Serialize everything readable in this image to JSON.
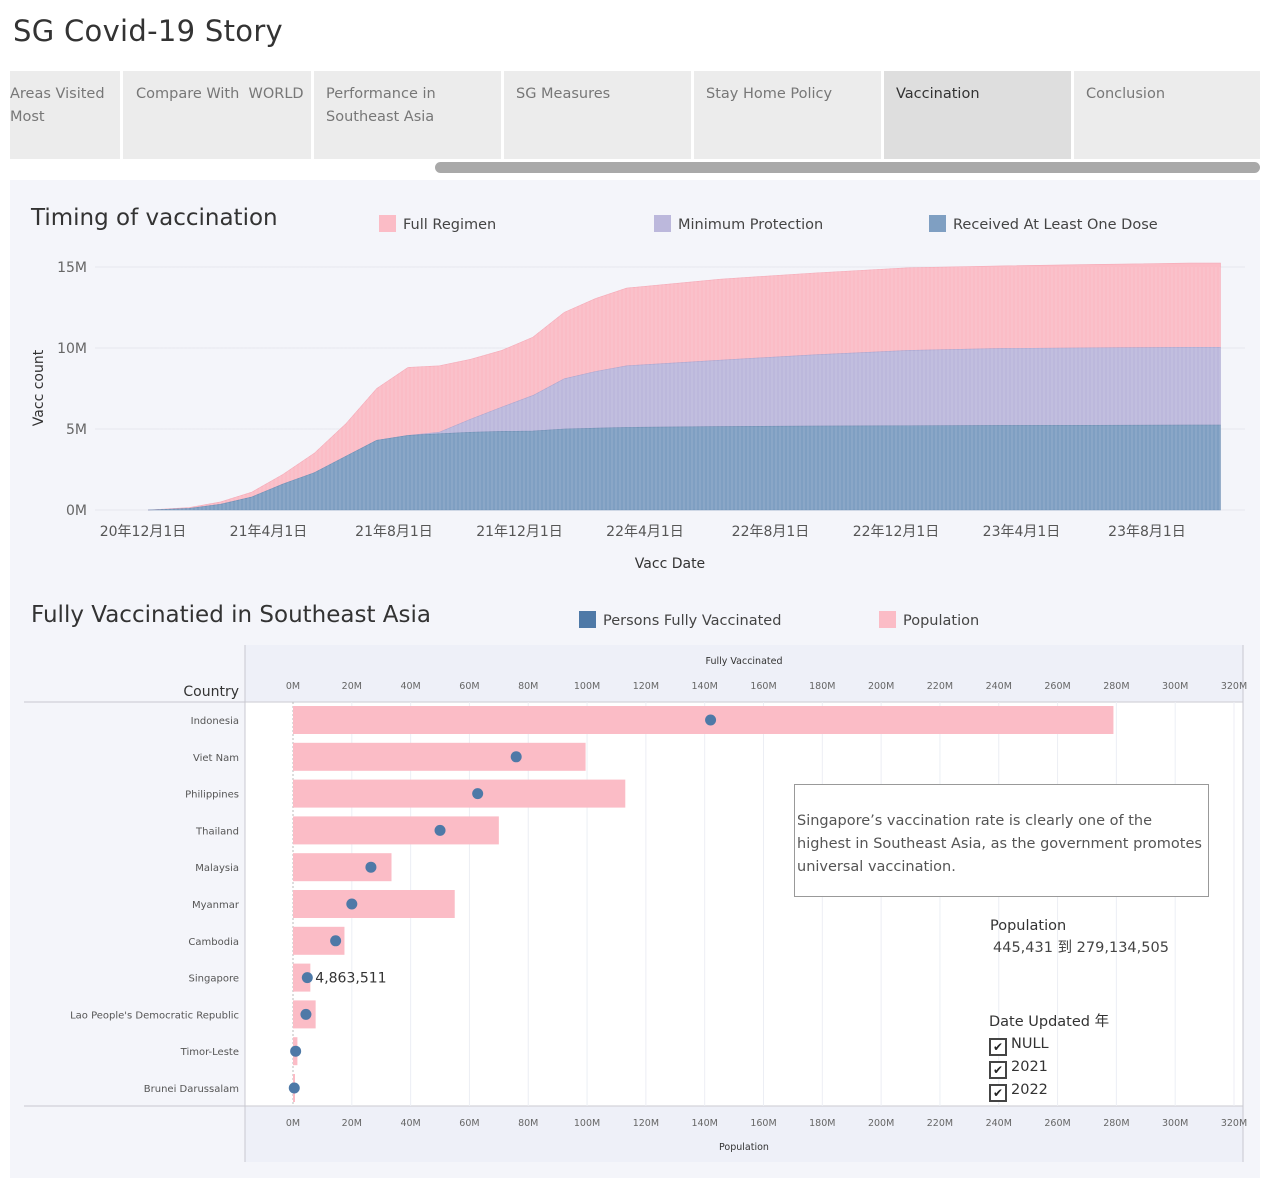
{
  "title": "SG Covid-19 Story",
  "tabs": [
    {
      "label": "Areas Visited Most",
      "active": false
    },
    {
      "label": "Compare With  WORLD",
      "active": false
    },
    {
      "label": "Performance in Southeast Asia",
      "active": false
    },
    {
      "label": "SG Measures",
      "active": false
    },
    {
      "label": "Stay Home Policy",
      "active": false
    },
    {
      "label": "Vaccination",
      "active": true
    },
    {
      "label": "Conclusion",
      "active": false
    }
  ],
  "colors": {
    "pink": "#fbbcc6",
    "lavender": "#bcb8dc",
    "blue": "#7f9fc2",
    "dot": "#4e79a7"
  },
  "timing": {
    "title": "Timing of vaccination",
    "legend": [
      {
        "label": "Full Regimen",
        "color": "#fbbcc6"
      },
      {
        "label": "Minimum Protection",
        "color": "#bcb8dc"
      },
      {
        "label": "Received At Least One Dose",
        "color": "#7f9fc2"
      }
    ]
  },
  "sea": {
    "title": "Fully Vaccinatied in Southeast Asia",
    "legend": [
      {
        "label": "Persons Fully Vaccinated",
        "color": "#4e79a7"
      },
      {
        "label": "Population",
        "color": "#fbbcc6"
      }
    ],
    "note": "Singapore’s vaccination rate is clearly one of the highest in Southeast Asia, as the government promotes universal vaccination.",
    "population_filter": {
      "label": "Population",
      "range": "445,431 到 279,134,505"
    },
    "date_filter": {
      "label": "Date Updated 年",
      "options": [
        "NULL",
        "2021",
        "2022"
      ]
    }
  },
  "chart_data": [
    {
      "type": "area",
      "title": "Timing of vaccination",
      "xlabel": "Vacc Date",
      "ylabel": "Vacc count",
      "x_ticks": [
        "20年12月1日",
        "21年4月1日",
        "21年8月1日",
        "21年12月1日",
        "22年4月1日",
        "22年8月1日",
        "22年12月1日",
        "23年4月1日",
        "23年8月1日"
      ],
      "y_ticks": [
        "0M",
        "5M",
        "10M",
        "15M"
      ],
      "ylim": [
        0,
        15000000
      ],
      "x": [
        "2021-01",
        "2021-02",
        "2021-03",
        "2021-04",
        "2021-05",
        "2021-06",
        "2021-07",
        "2021-08",
        "2021-09",
        "2021-10",
        "2021-11",
        "2021-12",
        "2022-01",
        "2022-02",
        "2022-03",
        "2022-06",
        "2022-09",
        "2022-12",
        "2023-03",
        "2023-06",
        "2023-09",
        "2023-10"
      ],
      "stacked": true,
      "series": [
        {
          "name": "Received At Least One Dose",
          "values": [
            100000,
            350000,
            800000,
            1600000,
            2300000,
            3300000,
            4300000,
            4600000,
            4700000,
            4800000,
            4850000,
            4870000,
            5000000,
            5050000,
            5100000,
            5150000,
            5180000,
            5200000,
            5220000,
            5230000,
            5240000,
            5240000
          ]
        },
        {
          "name": "Minimum Protection",
          "values": [
            0,
            0,
            0,
            0,
            0,
            0,
            0,
            0,
            100000,
            800000,
            1500000,
            2200000,
            3100000,
            3500000,
            3800000,
            4100000,
            4400000,
            4650000,
            4750000,
            4780000,
            4800000,
            4800000
          ]
        },
        {
          "name": "Full Regimen",
          "values": [
            50000,
            150000,
            300000,
            600000,
            1200000,
            2000000,
            3200000,
            4200000,
            4100000,
            3700000,
            3500000,
            3600000,
            4100000,
            4500000,
            4800000,
            5000000,
            5050000,
            5100000,
            5100000,
            5150000,
            5200000,
            5200000
          ]
        }
      ]
    },
    {
      "type": "bar",
      "title": "Fully Vaccinatied in Southeast Asia",
      "ylabel": "Country",
      "xlabel_top": "Fully Vaccinated",
      "xlabel_bottom": "Population",
      "x_ticks": [
        "0M",
        "20M",
        "40M",
        "60M",
        "80M",
        "100M",
        "120M",
        "140M",
        "160M",
        "180M",
        "200M",
        "220M",
        "240M",
        "260M",
        "280M",
        "300M",
        "320M"
      ],
      "xlim": [
        0,
        320000000
      ],
      "categories": [
        "Indonesia",
        "Viet Nam",
        "Philippines",
        "Thailand",
        "Malaysia",
        "Myanmar",
        "Cambodia",
        "Singapore",
        "Lao People's Democratic Republic",
        "Timor-Leste",
        "Brunei Darussalam"
      ],
      "series": [
        {
          "name": "Population",
          "values": [
            279000000,
            99500000,
            113000000,
            70000000,
            33500000,
            55000000,
            17500000,
            5900000,
            7700000,
            1500000,
            445431
          ]
        },
        {
          "name": "Persons Fully Vaccinated",
          "values": [
            142000000,
            75900000,
            62800000,
            50000000,
            26500000,
            20000000,
            14500000,
            4863511,
            4400000,
            900000,
            430000
          ]
        }
      ],
      "data_labels": [
        {
          "category": "Singapore",
          "text": "4,863,511"
        }
      ]
    }
  ]
}
